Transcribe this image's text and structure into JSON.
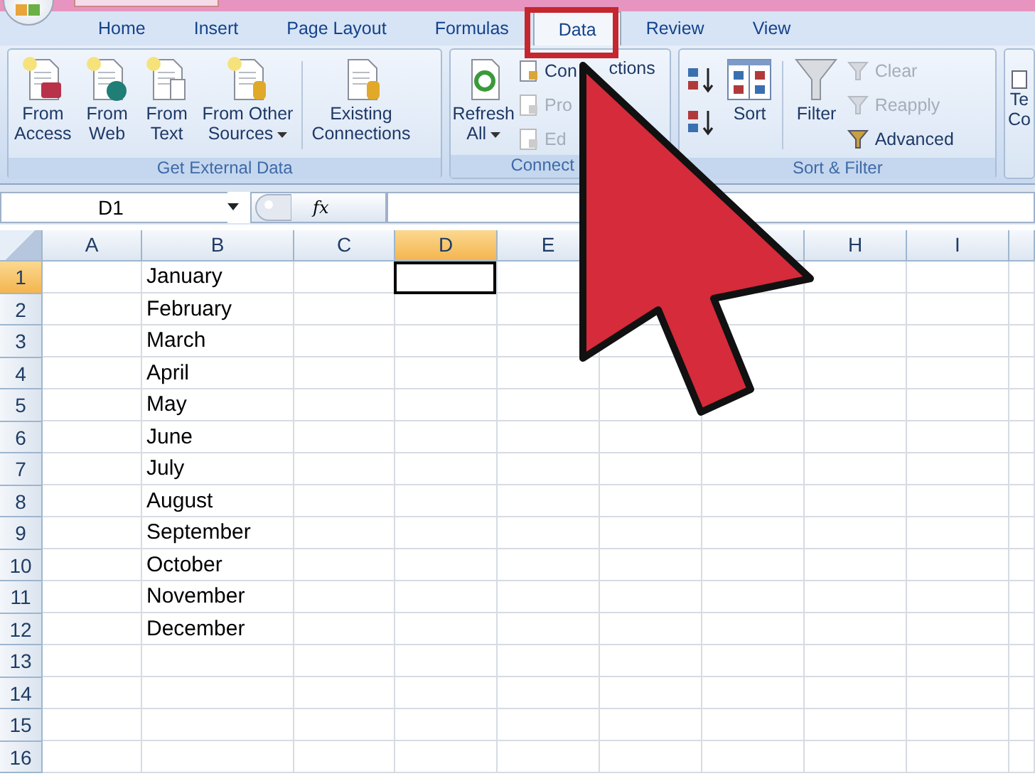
{
  "tabs": [
    {
      "label": "Home",
      "selected": false
    },
    {
      "label": "Insert",
      "selected": false
    },
    {
      "label": "Page Layout",
      "selected": false
    },
    {
      "label": "Formulas",
      "selected": false
    },
    {
      "label": "Data",
      "selected": true
    },
    {
      "label": "Review",
      "selected": false
    },
    {
      "label": "View",
      "selected": false
    }
  ],
  "ribbon_groups": [
    {
      "label": "Get External Data",
      "kind": "large",
      "buttons": [
        {
          "lines": [
            "From",
            "Access"
          ],
          "has_menu": false
        },
        {
          "lines": [
            "From",
            "Web"
          ],
          "has_menu": false
        },
        {
          "lines": [
            "From",
            "Text"
          ],
          "has_menu": false
        },
        {
          "lines": [
            "From Other",
            "Sources"
          ],
          "has_menu": true
        },
        {
          "lines": [
            "Existing",
            "Connections"
          ],
          "has_menu": false
        }
      ]
    },
    {
      "label": "Connect",
      "kind": "connections",
      "refresh": {
        "lines": [
          "Refresh",
          "All"
        ],
        "has_menu": true
      },
      "items": [
        {
          "label": "Con",
          "disabled": false
        },
        {
          "label": "Pro",
          "disabled": true
        },
        {
          "label": "Ed",
          "disabled": true
        }
      ],
      "item_tail": "ctions"
    },
    {
      "label": "Sort & Filter",
      "kind": "sort",
      "sort": {
        "label": "Sort"
      },
      "filter": {
        "label": "Filter"
      },
      "items": [
        {
          "label": "Clear",
          "disabled": true
        },
        {
          "label": "Reapply",
          "disabled": true
        },
        {
          "label": "Advanced",
          "disabled": false
        }
      ]
    },
    {
      "kind": "cut",
      "lines": [
        "Te",
        "Co"
      ]
    }
  ],
  "formula_bar": {
    "name_box": "D1",
    "function_label": "fx"
  },
  "columns": [
    {
      "kind": "letter",
      "label": "A",
      "selected": false
    },
    {
      "kind": "letter",
      "label": "B",
      "selected": false
    },
    {
      "kind": "letter",
      "label": "C",
      "selected": false
    },
    {
      "kind": "letter",
      "label": "D",
      "selected": true
    },
    {
      "kind": "letter",
      "label": "E",
      "selected": false
    },
    {
      "kind": "covered"
    },
    {
      "kind": "blank"
    },
    {
      "kind": "letter",
      "label": "H",
      "selected": false
    },
    {
      "kind": "letter",
      "label": "I",
      "selected": false
    },
    {
      "kind": "blank"
    }
  ],
  "rows": [
    {
      "number": "1",
      "selected": true,
      "b": "January"
    },
    {
      "number": "2",
      "selected": false,
      "b": "February"
    },
    {
      "number": "3",
      "selected": false,
      "b": "March"
    },
    {
      "number": "4",
      "selected": false,
      "b": "April"
    },
    {
      "number": "5",
      "selected": false,
      "b": "May"
    },
    {
      "number": "6",
      "selected": false,
      "b": "June"
    },
    {
      "number": "7",
      "selected": false,
      "b": "July"
    },
    {
      "number": "8",
      "selected": false,
      "b": "August"
    },
    {
      "number": "9",
      "selected": false,
      "b": "September"
    },
    {
      "number": "10",
      "selected": false,
      "b": "October"
    },
    {
      "number": "11",
      "selected": false,
      "b": "November"
    },
    {
      "number": "12",
      "selected": false,
      "b": "December"
    },
    {
      "number": "13",
      "selected": false
    },
    {
      "number": "14",
      "selected": false
    },
    {
      "number": "15",
      "selected": false
    },
    {
      "number": "16",
      "selected": false
    }
  ]
}
